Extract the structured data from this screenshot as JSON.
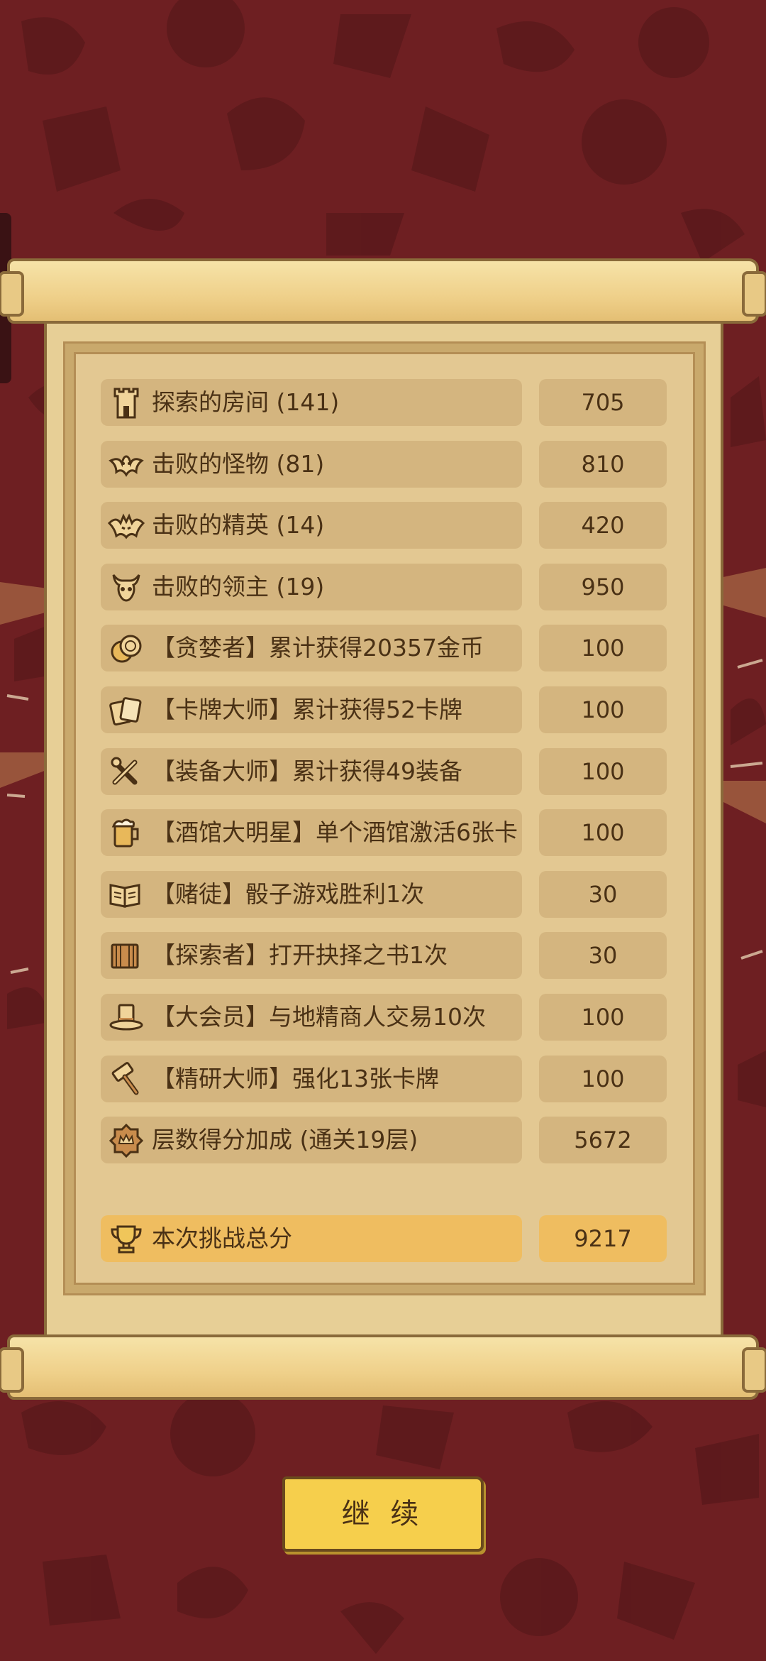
{
  "colors": {
    "background": "#6e1f22",
    "pattern": "#5a181b",
    "parchment": "#e7cf96",
    "row": "#d4b57f",
    "total_row": "#efbd60",
    "text": "#4a3115",
    "button": "#f6cf4c"
  },
  "score_rows": [
    {
      "icon": "tower-icon",
      "label": "探索的房间 (141)",
      "value": "705"
    },
    {
      "icon": "bat-icon",
      "label": "击败的怪物 (81)",
      "value": "810"
    },
    {
      "icon": "demon-bat-icon",
      "label": "击败的精英 (14)",
      "value": "420"
    },
    {
      "icon": "horned-skull-icon",
      "label": "击败的领主 (19)",
      "value": "950"
    },
    {
      "icon": "coins-icon",
      "label": "【贪婪者】累计获得20357金币",
      "value": "100"
    },
    {
      "icon": "cards-icon",
      "label": "【卡牌大师】累计获得52卡牌",
      "value": "100"
    },
    {
      "icon": "crossed-tools-icon",
      "label": "【装备大师】累计获得49装备",
      "value": "100"
    },
    {
      "icon": "beer-mug-icon",
      "label": "【酒馆大明星】单个酒馆激活6张卡",
      "value": "100"
    },
    {
      "icon": "open-book-icon",
      "label": "【赌徒】骰子游戏胜利1次",
      "value": "30"
    },
    {
      "icon": "closed-book-icon",
      "label": "【探索者】打开抉择之书1次",
      "value": "30"
    },
    {
      "icon": "top-hat-icon",
      "label": "【大会员】与地精商人交易10次",
      "value": "100"
    },
    {
      "icon": "hammer-icon",
      "label": "【精研大师】强化13张卡牌",
      "value": "100"
    },
    {
      "icon": "badge-icon",
      "label": "层数得分加成 (通关19层)",
      "value": "5672"
    }
  ],
  "total": {
    "icon": "trophy-icon",
    "label": "本次挑战总分",
    "value": "9217"
  },
  "continue_button": "继 续"
}
